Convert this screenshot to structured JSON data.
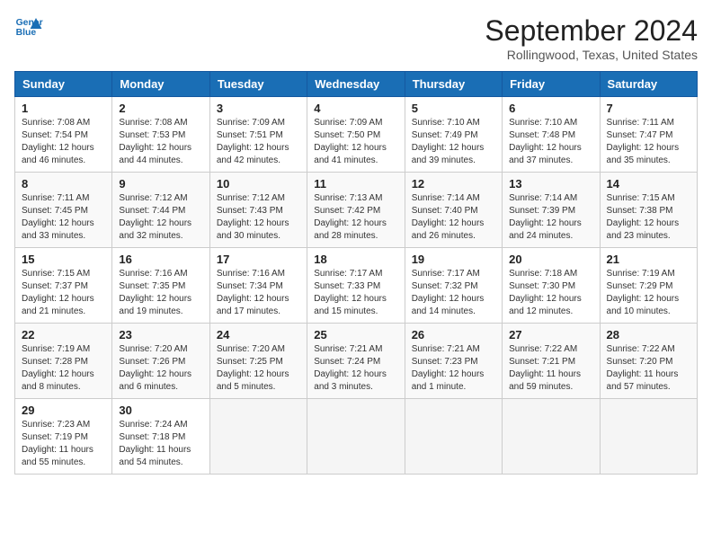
{
  "header": {
    "logo_line1": "General",
    "logo_line2": "Blue",
    "month_title": "September 2024",
    "location": "Rollingwood, Texas, United States"
  },
  "weekdays": [
    "Sunday",
    "Monday",
    "Tuesday",
    "Wednesday",
    "Thursday",
    "Friday",
    "Saturday"
  ],
  "weeks": [
    [
      {
        "day": 1,
        "sunrise": "7:08 AM",
        "sunset": "7:54 PM",
        "daylight": "12 hours and 46 minutes."
      },
      {
        "day": 2,
        "sunrise": "7:08 AM",
        "sunset": "7:53 PM",
        "daylight": "12 hours and 44 minutes."
      },
      {
        "day": 3,
        "sunrise": "7:09 AM",
        "sunset": "7:51 PM",
        "daylight": "12 hours and 42 minutes."
      },
      {
        "day": 4,
        "sunrise": "7:09 AM",
        "sunset": "7:50 PM",
        "daylight": "12 hours and 41 minutes."
      },
      {
        "day": 5,
        "sunrise": "7:10 AM",
        "sunset": "7:49 PM",
        "daylight": "12 hours and 39 minutes."
      },
      {
        "day": 6,
        "sunrise": "7:10 AM",
        "sunset": "7:48 PM",
        "daylight": "12 hours and 37 minutes."
      },
      {
        "day": 7,
        "sunrise": "7:11 AM",
        "sunset": "7:47 PM",
        "daylight": "12 hours and 35 minutes."
      }
    ],
    [
      {
        "day": 8,
        "sunrise": "7:11 AM",
        "sunset": "7:45 PM",
        "daylight": "12 hours and 33 minutes."
      },
      {
        "day": 9,
        "sunrise": "7:12 AM",
        "sunset": "7:44 PM",
        "daylight": "12 hours and 32 minutes."
      },
      {
        "day": 10,
        "sunrise": "7:12 AM",
        "sunset": "7:43 PM",
        "daylight": "12 hours and 30 minutes."
      },
      {
        "day": 11,
        "sunrise": "7:13 AM",
        "sunset": "7:42 PM",
        "daylight": "12 hours and 28 minutes."
      },
      {
        "day": 12,
        "sunrise": "7:14 AM",
        "sunset": "7:40 PM",
        "daylight": "12 hours and 26 minutes."
      },
      {
        "day": 13,
        "sunrise": "7:14 AM",
        "sunset": "7:39 PM",
        "daylight": "12 hours and 24 minutes."
      },
      {
        "day": 14,
        "sunrise": "7:15 AM",
        "sunset": "7:38 PM",
        "daylight": "12 hours and 23 minutes."
      }
    ],
    [
      {
        "day": 15,
        "sunrise": "7:15 AM",
        "sunset": "7:37 PM",
        "daylight": "12 hours and 21 minutes."
      },
      {
        "day": 16,
        "sunrise": "7:16 AM",
        "sunset": "7:35 PM",
        "daylight": "12 hours and 19 minutes."
      },
      {
        "day": 17,
        "sunrise": "7:16 AM",
        "sunset": "7:34 PM",
        "daylight": "12 hours and 17 minutes."
      },
      {
        "day": 18,
        "sunrise": "7:17 AM",
        "sunset": "7:33 PM",
        "daylight": "12 hours and 15 minutes."
      },
      {
        "day": 19,
        "sunrise": "7:17 AM",
        "sunset": "7:32 PM",
        "daylight": "12 hours and 14 minutes."
      },
      {
        "day": 20,
        "sunrise": "7:18 AM",
        "sunset": "7:30 PM",
        "daylight": "12 hours and 12 minutes."
      },
      {
        "day": 21,
        "sunrise": "7:19 AM",
        "sunset": "7:29 PM",
        "daylight": "12 hours and 10 minutes."
      }
    ],
    [
      {
        "day": 22,
        "sunrise": "7:19 AM",
        "sunset": "7:28 PM",
        "daylight": "12 hours and 8 minutes."
      },
      {
        "day": 23,
        "sunrise": "7:20 AM",
        "sunset": "7:26 PM",
        "daylight": "12 hours and 6 minutes."
      },
      {
        "day": 24,
        "sunrise": "7:20 AM",
        "sunset": "7:25 PM",
        "daylight": "12 hours and 5 minutes."
      },
      {
        "day": 25,
        "sunrise": "7:21 AM",
        "sunset": "7:24 PM",
        "daylight": "12 hours and 3 minutes."
      },
      {
        "day": 26,
        "sunrise": "7:21 AM",
        "sunset": "7:23 PM",
        "daylight": "12 hours and 1 minute."
      },
      {
        "day": 27,
        "sunrise": "7:22 AM",
        "sunset": "7:21 PM",
        "daylight": "11 hours and 59 minutes."
      },
      {
        "day": 28,
        "sunrise": "7:22 AM",
        "sunset": "7:20 PM",
        "daylight": "11 hours and 57 minutes."
      }
    ],
    [
      {
        "day": 29,
        "sunrise": "7:23 AM",
        "sunset": "7:19 PM",
        "daylight": "11 hours and 55 minutes."
      },
      {
        "day": 30,
        "sunrise": "7:24 AM",
        "sunset": "7:18 PM",
        "daylight": "11 hours and 54 minutes."
      },
      null,
      null,
      null,
      null,
      null
    ]
  ]
}
